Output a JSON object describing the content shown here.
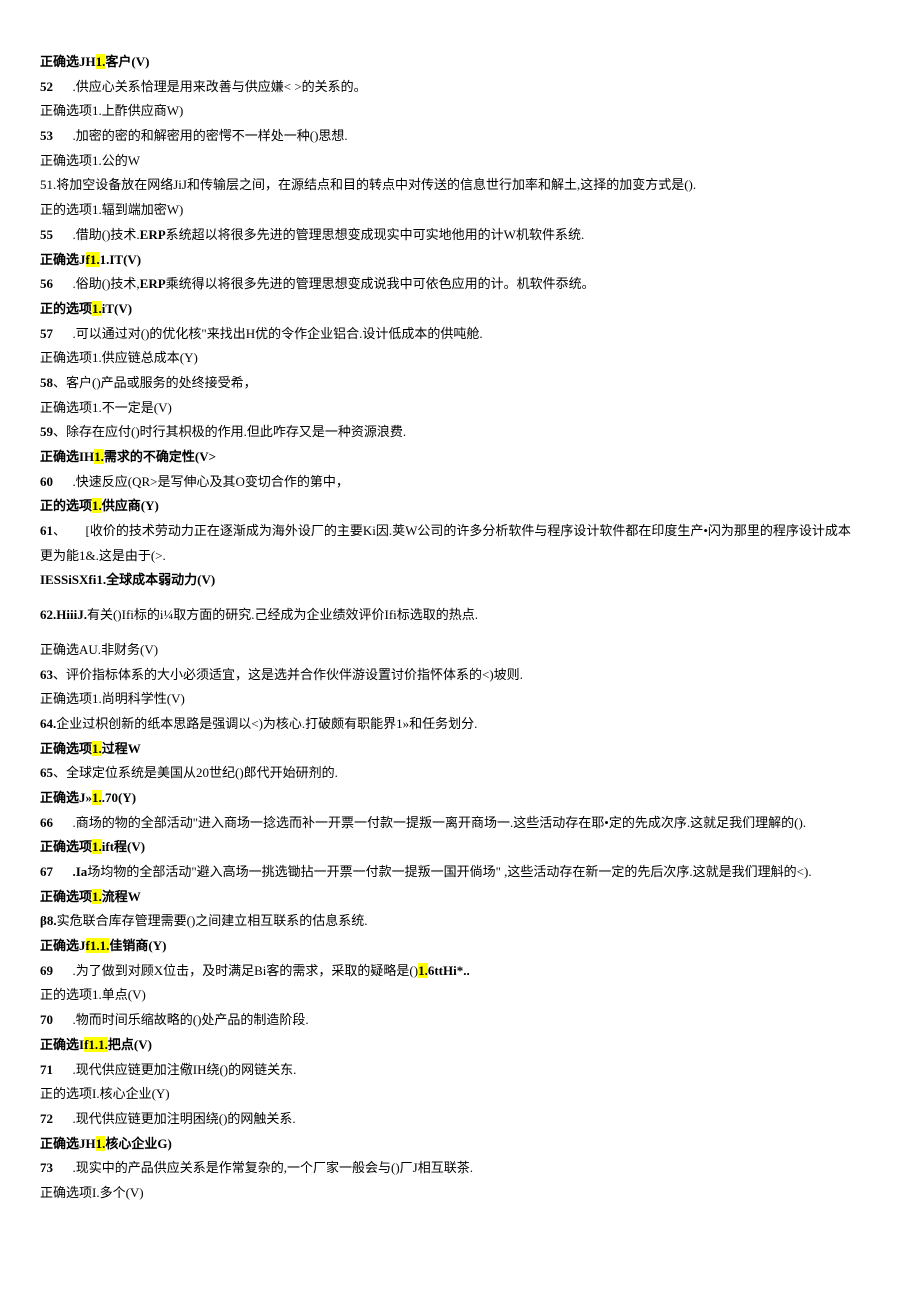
{
  "lines": [
    {
      "segs": [
        {
          "t": "正确选JH",
          "b": true
        },
        {
          "t": "1.",
          "b": true,
          "h": true
        },
        {
          "t": "客户(V)",
          "b": true
        }
      ]
    },
    {
      "segs": [
        {
          "t": "52",
          "b": true
        },
        {
          "sp": true
        },
        {
          "t": ".供应心关系恰理是用来改善与供应嫌< >的关系的。"
        }
      ]
    },
    {
      "segs": [
        {
          "t": "正确选项1.上酢供应商W)"
        }
      ]
    },
    {
      "segs": [
        {
          "t": "53",
          "b": true
        },
        {
          "sp": true
        },
        {
          "t": ".加密的密的和解密用的密愕不一样处一种()思想."
        }
      ]
    },
    {
      "segs": [
        {
          "t": "正确选项1.公的W"
        }
      ]
    },
    {
      "segs": [
        {
          "t": "51.将加空设备放在网络JiJ和传输层之间，在源结点和目的转点中对传送的信息世行加率和解土,这择的加变方式是()."
        }
      ]
    },
    {
      "segs": [
        {
          "t": "正的选项1.辐到端加密W)"
        }
      ]
    },
    {
      "segs": [
        {
          "t": "55",
          "b": true
        },
        {
          "sp": true
        },
        {
          "t": ".借助()技术."
        },
        {
          "t": "ERP",
          "b": true
        },
        {
          "t": "系统超以将很多先进的管理思想变成现实中可实地他用的计W机软件系统."
        }
      ]
    },
    {
      "segs": [
        {
          "t": "正确选J",
          "b": true
        },
        {
          "t": "f1.",
          "b": true,
          "h": true
        },
        {
          "t": "1.IT(V)",
          "b": true
        }
      ]
    },
    {
      "segs": [
        {
          "t": "56",
          "b": true
        },
        {
          "sp": true
        },
        {
          "t": ".俗助()技术,"
        },
        {
          "t": "ERP",
          "b": true
        },
        {
          "t": "乘统得以将很多先进的管理思想变成说我中可依色应用的计。机软件忝统。"
        }
      ]
    },
    {
      "segs": [
        {
          "t": "正的选项",
          "b": true
        },
        {
          "t": "1.",
          "b": true,
          "h": true
        },
        {
          "t": "iT(V)",
          "b": true
        }
      ]
    },
    {
      "segs": [
        {
          "t": "57",
          "b": true
        },
        {
          "sp": true
        },
        {
          "t": ".可以通过对()的优化核\"来找出H优的令作企业铝合.设计低成本的供吨舱."
        }
      ]
    },
    {
      "segs": [
        {
          "t": "正确选项1.供应链总成本(Y)"
        }
      ]
    },
    {
      "segs": [
        {
          "t": "58",
          "b": true
        },
        {
          "t": "、客户()产品或服务的处终接受希，"
        }
      ]
    },
    {
      "segs": [
        {
          "t": "正确选项1.不一定是(V)"
        }
      ]
    },
    {
      "segs": [
        {
          "t": "59",
          "b": true
        },
        {
          "t": "、除存在应付()时行其枳极的作用.但此咋存又是一种资源浪费."
        }
      ]
    },
    {
      "segs": [
        {
          "t": "正确选IH",
          "b": true
        },
        {
          "t": "1.",
          "b": true,
          "h": true
        },
        {
          "t": "需求的不确定性(V>",
          "b": true
        }
      ]
    },
    {
      "segs": [
        {
          "t": "60",
          "b": true
        },
        {
          "sp": true
        },
        {
          "t": ".快速反应(QR>是写伸心及其O变切合作的第中，"
        }
      ]
    },
    {
      "segs": [
        {
          "t": "正的选项",
          "b": true
        },
        {
          "t": "1.",
          "b": true,
          "h": true
        },
        {
          "t": "供应商(Y)",
          "b": true
        }
      ]
    },
    {
      "segs": [
        {
          "t": "61",
          "b": true
        },
        {
          "t": "、"
        },
        {
          "sp": true
        },
        {
          "t": "[收价的技术劳动力正在逐渐成为海外设厂的主要Ki因.荚W公司的许多分析软件与程序设计软件都在印度生产•闪为那里的程序设计成本"
        }
      ]
    },
    {
      "segs": [
        {
          "t": "更为能1&.这是由于(>."
        }
      ]
    },
    {
      "segs": [
        {
          "t": "IESSiSXfi1.全球成本弱动力(V)",
          "b": true
        }
      ]
    },
    {
      "gap": true
    },
    {
      "segs": [
        {
          "t": "62.HiiiJ.",
          "b": true
        },
        {
          "t": "有关()Ifi标的i¼取方面的研究.己经成为企业绩效评价Ifi标选取的热点."
        }
      ]
    },
    {
      "gap": true
    },
    {
      "segs": [
        {
          "t": "正确选AU.非财务(V)"
        }
      ]
    },
    {
      "segs": [
        {
          "t": "63",
          "b": true
        },
        {
          "t": "、评价指标体系的大小必须适宜，这是选并合作伙伴游设置讨价指怀体系的<)坡则."
        }
      ]
    },
    {
      "segs": [
        {
          "t": "正确选项1.尚明科学性(V)"
        }
      ]
    },
    {
      "segs": [
        {
          "t": "64.",
          "b": true
        },
        {
          "t": "企业过枳创新的纸本思路是强调以<)为核心.打破颇有职能界1»和任务划分."
        }
      ]
    },
    {
      "segs": [
        {
          "t": "正确选项",
          "b": true
        },
        {
          "t": "1.",
          "b": true,
          "h": true
        },
        {
          "t": "过程W",
          "b": true
        }
      ]
    },
    {
      "segs": [
        {
          "t": "65",
          "b": true
        },
        {
          "t": "、全球定位系统是美国从20世纪()郎代开始研剂的."
        }
      ]
    },
    {
      "segs": [
        {
          "t": "正确选J»",
          "b": true
        },
        {
          "t": "1.",
          "b": true,
          "h": true
        },
        {
          "t": ".70(Y)",
          "b": true
        }
      ]
    },
    {
      "segs": [
        {
          "t": "66",
          "b": true
        },
        {
          "sp": true
        },
        {
          "t": ".商场的物的全部活动\"进入商场一捻选而补一开票一付款一提叛一离开商场一.这些活动存在耶•定的先成次序.这就足我们理解的()."
        }
      ]
    },
    {
      "segs": [
        {
          "t": "正确选项",
          "b": true
        },
        {
          "t": "1.",
          "b": true,
          "h": true
        },
        {
          "t": "ift程(V)",
          "b": true
        }
      ]
    },
    {
      "segs": [
        {
          "t": "67",
          "b": true
        },
        {
          "sp": true
        },
        {
          "t": ".Ia",
          "b": true
        },
        {
          "t": "场均物的全部活动\"避入高场一挑选锄拈一开票一付款一提叛一国开倘场\" ,这些活动存在新一定的先后次序.这就是我们理斛的<)."
        }
      ]
    },
    {
      "segs": [
        {
          "t": "正确选项",
          "b": true
        },
        {
          "t": "1.",
          "b": true,
          "h": true
        },
        {
          "t": "流程W",
          "b": true
        }
      ]
    },
    {
      "segs": [
        {
          "t": "β8.",
          "b": true
        },
        {
          "t": "实危联合库存管理需要()之间建立相互联系的估息系统."
        }
      ]
    },
    {
      "segs": [
        {
          "t": "正确选J",
          "b": true
        },
        {
          "t": "f1.1.",
          "b": true,
          "h": true
        },
        {
          "t": "佳销商(Y)",
          "b": true
        }
      ]
    },
    {
      "segs": [
        {
          "t": "69",
          "b": true
        },
        {
          "sp": true
        },
        {
          "t": ".为了做到对顾X位击，及时满足Bi客的需求，采取的疑略是()"
        },
        {
          "t": "1.",
          "b": true,
          "h": true
        },
        {
          "t": "6ttHi*..",
          "b": true
        }
      ]
    },
    {
      "segs": [
        {
          "t": "正的选项1.单点(V)"
        }
      ]
    },
    {
      "segs": [
        {
          "t": "70",
          "b": true
        },
        {
          "sp": true
        },
        {
          "t": ".物而时间乐缩故略的()处产品的制造阶段."
        }
      ]
    },
    {
      "segs": [
        {
          "t": "正确选I",
          "b": true
        },
        {
          "t": "f1.1.",
          "b": true,
          "h": true
        },
        {
          "t": "把点(V)",
          "b": true
        }
      ]
    },
    {
      "segs": [
        {
          "t": "71",
          "b": true
        },
        {
          "sp": true
        },
        {
          "t": ".现代供应链更加注儆IH绕()的网链关东."
        }
      ]
    },
    {
      "segs": [
        {
          "t": "正的选项I.核心企业(Y)"
        }
      ]
    },
    {
      "segs": [
        {
          "t": "72",
          "b": true
        },
        {
          "sp": true
        },
        {
          "t": ".现代供应链更加注明困绕()的网触关系."
        }
      ]
    },
    {
      "segs": [
        {
          "t": "正确选JH",
          "b": true
        },
        {
          "t": "1.",
          "b": true,
          "h": true
        },
        {
          "t": "核心企业G)",
          "b": true
        }
      ]
    },
    {
      "segs": [
        {
          "t": "73",
          "b": true
        },
        {
          "sp": true
        },
        {
          "t": ".现实中的产品供应关系是作常复杂的,一个厂家一般会与()厂J相互联茶."
        }
      ]
    },
    {
      "segs": [
        {
          "t": "正确选项I.多个(V)"
        }
      ]
    }
  ]
}
